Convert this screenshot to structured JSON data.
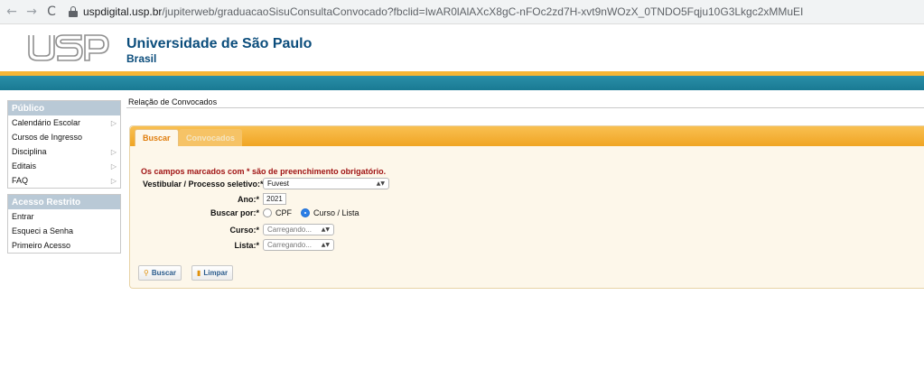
{
  "browser": {
    "back": "←",
    "forward": "→",
    "reload": "C",
    "url_host": "uspdigital.usp.br",
    "url_path": "/jupiterweb/graduacaoSisuConsultaConvocado?fbclid=IwAR0lAlAXcX8gC-nFOc2zd7H-xvt9nWOzX_0TNDO5Fqju10G3Lkgc2xMMuEI"
  },
  "header": {
    "logo_text": "USP",
    "university": "Universidade de São Paulo",
    "country": "Brasil"
  },
  "sidebar": {
    "public": {
      "title": "Público",
      "items": [
        {
          "label": "Calendário Escolar",
          "has_arrow": true
        },
        {
          "label": "Cursos de Ingresso",
          "has_arrow": false
        },
        {
          "label": "Disciplina",
          "has_arrow": true
        },
        {
          "label": "Editais",
          "has_arrow": true
        },
        {
          "label": "FAQ",
          "has_arrow": true
        }
      ]
    },
    "restricted": {
      "title": "Acesso Restrito",
      "items": [
        {
          "label": "Entrar"
        },
        {
          "label": "Esqueci a Senha"
        },
        {
          "label": "Primeiro Acesso"
        }
      ]
    },
    "arrow_glyph": "▷"
  },
  "main": {
    "page_title": "Relação de Convocados",
    "tabs": {
      "buscar": "Buscar",
      "convocados": "Convocados"
    },
    "required_note": "Os campos marcados com * são de preenchimento obrigatório.",
    "form": {
      "vestibular_label": "Vestibular / Processo seletivo:*",
      "vestibular_value": "Fuvest",
      "ano_label": "Ano:*",
      "ano_value": "2021",
      "buscar_por_label": "Buscar por:*",
      "option_cpf": "CPF",
      "option_curso": "Curso / Lista",
      "curso_label": "Curso:*",
      "curso_value": "Carregando...",
      "lista_label": "Lista:*",
      "lista_value": "Carregando..."
    },
    "buttons": {
      "buscar": "Buscar",
      "limpar": "Limpar"
    }
  },
  "colors": {
    "brand_blue": "#0b4d7c",
    "stripe_yellow": "#f6b635",
    "stripe_teal": "#2a8fa8",
    "tab_orange": "#f0a523",
    "required_red": "#a01414"
  }
}
